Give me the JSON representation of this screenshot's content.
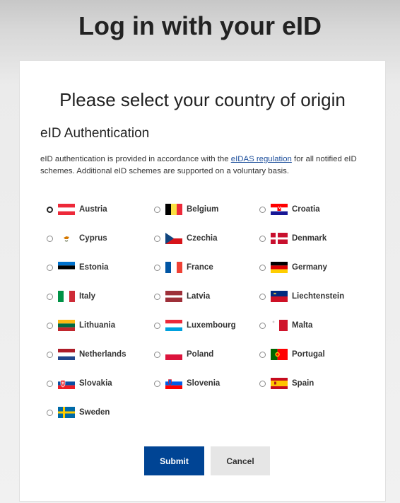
{
  "page": {
    "title": "Log in with your eID"
  },
  "card": {
    "heading": "Please select your country of origin",
    "subheading": "eID Authentication",
    "description_pre": "eID authentication is provided in accordance with the ",
    "description_link": "eIDAS regulation",
    "description_post": " for all notified eID schemes. Additional eID schemes are supported on a voluntary basis."
  },
  "countries": [
    {
      "name": "Austria",
      "flag": "austria-flag",
      "selected": true
    },
    {
      "name": "Belgium",
      "flag": "belgium-flag"
    },
    {
      "name": "Croatia",
      "flag": "croatia-flag"
    },
    {
      "name": "Cyprus",
      "flag": "cyprus-flag"
    },
    {
      "name": "Czechia",
      "flag": "czechia-flag"
    },
    {
      "name": "Denmark",
      "flag": "denmark-flag"
    },
    {
      "name": "Estonia",
      "flag": "estonia-flag"
    },
    {
      "name": "France",
      "flag": "france-flag"
    },
    {
      "name": "Germany",
      "flag": "germany-flag"
    },
    {
      "name": "Italy",
      "flag": "italy-flag"
    },
    {
      "name": "Latvia",
      "flag": "latvia-flag"
    },
    {
      "name": "Liechtenstein",
      "flag": "liechtenstein-flag"
    },
    {
      "name": "Lithuania",
      "flag": "lithuania-flag"
    },
    {
      "name": "Luxembourg",
      "flag": "luxembourg-flag"
    },
    {
      "name": "Malta",
      "flag": "malta-flag"
    },
    {
      "name": "Netherlands",
      "flag": "netherlands-flag"
    },
    {
      "name": "Poland",
      "flag": "poland-flag"
    },
    {
      "name": "Portugal",
      "flag": "portugal-flag"
    },
    {
      "name": "Slovakia",
      "flag": "slovakia-flag"
    },
    {
      "name": "Slovenia",
      "flag": "slovenia-flag"
    },
    {
      "name": "Spain",
      "flag": "spain-flag"
    },
    {
      "name": "Sweden",
      "flag": "sweden-flag"
    }
  ],
  "buttons": {
    "submit": "Submit",
    "cancel": "Cancel"
  },
  "colors": {
    "primary": "#004494",
    "link": "#1d4f9c",
    "secondary": "#e6e6e6"
  }
}
